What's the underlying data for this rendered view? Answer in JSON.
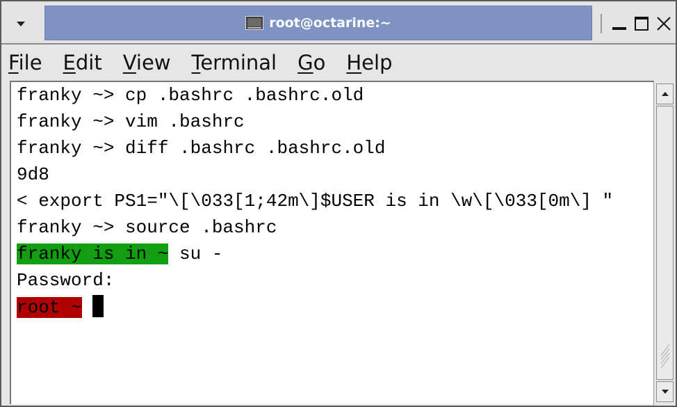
{
  "window": {
    "title": "root@octarine:~",
    "icons": {
      "window_menu": "chevron-down-icon",
      "title_icon": "terminal-icon",
      "minimize": "minimize-icon",
      "maximize": "maximize-icon",
      "close": "close-icon"
    }
  },
  "menubar": {
    "items": [
      {
        "mnemonic": "F",
        "rest": "ile"
      },
      {
        "mnemonic": "E",
        "rest": "dit"
      },
      {
        "mnemonic": "V",
        "rest": "iew"
      },
      {
        "mnemonic": "T",
        "rest": "erminal"
      },
      {
        "mnemonic": "G",
        "rest": "o"
      },
      {
        "mnemonic": "H",
        "rest": "elp"
      }
    ]
  },
  "terminal": {
    "lines": [
      "franky ~> cp .bashrc .bashrc.old",
      "franky ~> vim .bashrc",
      "franky ~> diff .bashrc .bashrc.old",
      "9d8",
      "< export PS1=\"\\[\\033[1;42m\\]$USER is in \\w\\[\\033[0m\\] \"",
      "franky ~> source .bashrc"
    ],
    "green_prompt": "franky is in ~",
    "green_command": " su -",
    "password_line": "Password:",
    "root_prompt": "root ~",
    "colors": {
      "green_prompt_bg": "#119e11",
      "root_prompt_bg": "#b00000",
      "title_bar_bg": "#7f93c3"
    }
  },
  "scrollbar": {
    "up_icon": "arrow-up-icon",
    "down_icon": "arrow-down-icon",
    "grip_icon": "grip-icon"
  }
}
